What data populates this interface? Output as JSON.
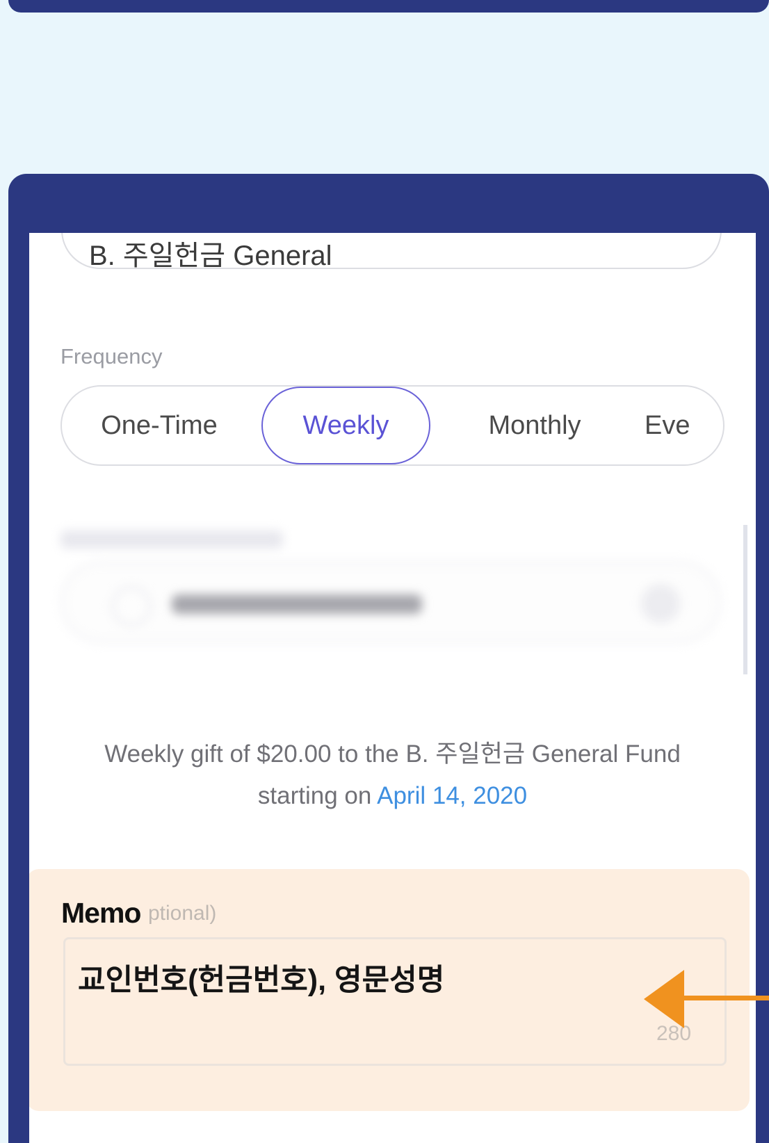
{
  "fund": {
    "selected": "B. 주일헌금 General"
  },
  "frequency": {
    "label": "Frequency",
    "options": [
      "One-Time",
      "Weekly",
      "Monthly",
      "Eve"
    ],
    "selected": "Weekly"
  },
  "summary": {
    "text": "Weekly gift of $20.00 to the B. 주일헌금 General Fund",
    "prefix": "starting on",
    "date": "April 14, 2020"
  },
  "memo": {
    "title": "Memo",
    "optional_hint": "ptional)",
    "value": "교인번호(헌금번호), 영문성명",
    "char_count": "280"
  },
  "colors": {
    "frame": "#2b3881",
    "accent": "#5a52d5",
    "link": "#3e8fe0",
    "memo_highlight": "#fdeee0",
    "arrow": "#f0921f"
  }
}
